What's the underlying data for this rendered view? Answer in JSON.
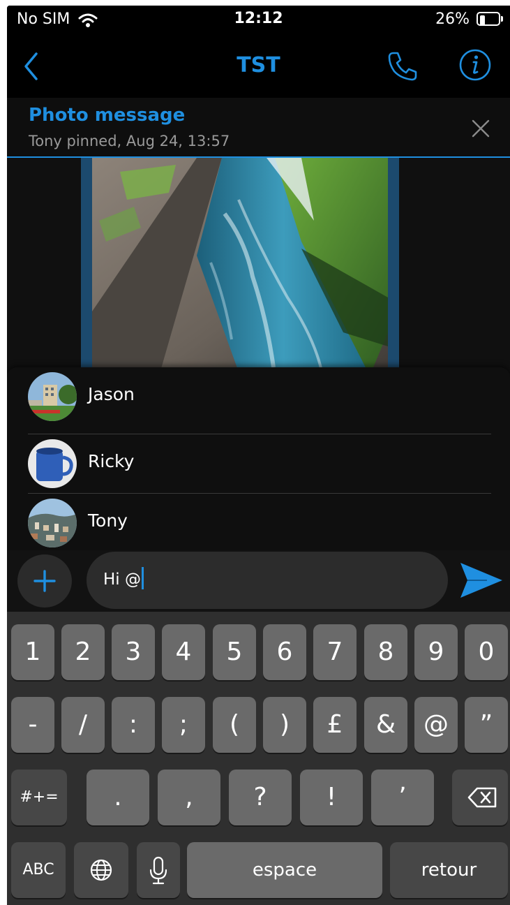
{
  "status_bar": {
    "carrier": "No SIM",
    "time": "12:12",
    "battery_percent": "26%",
    "battery_level": 0.26
  },
  "nav": {
    "title": "TST",
    "back": "back",
    "call": "call",
    "info": "info"
  },
  "pinned": {
    "title": "Photo message",
    "subtitle": "Tony pinned, Aug 24, 13:57"
  },
  "mentions": [
    {
      "name": "Jason",
      "avatar": "buildings-garden"
    },
    {
      "name": "Ricky",
      "avatar": "blue-mug"
    },
    {
      "name": "Tony",
      "avatar": "city-view"
    }
  ],
  "composer": {
    "text": "Hi @"
  },
  "keyboard": {
    "row1": [
      "1",
      "2",
      "3",
      "4",
      "5",
      "6",
      "7",
      "8",
      "9",
      "0"
    ],
    "row2": [
      "-",
      "/",
      ":",
      ";",
      "(",
      ")",
      "£",
      "&",
      "@",
      "”"
    ],
    "row3": {
      "shift": "#+=",
      "keys": [
        ".",
        ",",
        "?",
        "!",
        "’"
      ]
    },
    "row4": {
      "abc": "ABC",
      "space": "espace",
      "return": "retour"
    }
  },
  "colors": {
    "accent": "#1f8fe0",
    "background": "#101010",
    "key": "#6a6a6a",
    "key_dark": "#474747"
  },
  "icons": [
    "wifi-icon",
    "battery-icon",
    "back-icon",
    "phone-icon",
    "info-icon",
    "close-icon",
    "plus-icon",
    "send-icon",
    "backspace-icon",
    "globe-icon",
    "mic-icon"
  ]
}
